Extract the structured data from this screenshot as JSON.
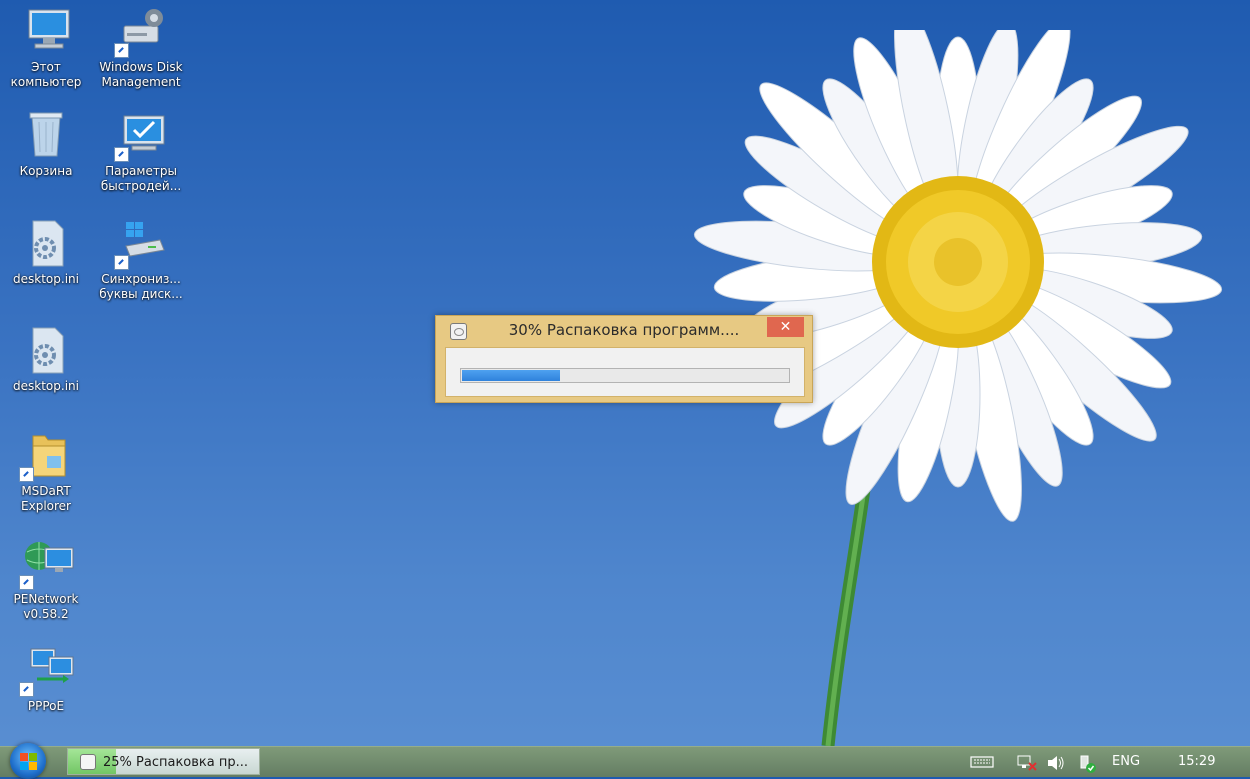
{
  "desktop": {
    "icons": [
      {
        "label": "Этот\nкомпьютер",
        "icon": "computer-icon"
      },
      {
        "label": "Windows Disk\nManagement",
        "icon": "disk-management-icon"
      },
      {
        "label": "Корзина",
        "icon": "recycle-bin-icon"
      },
      {
        "label": "Параметры\nбыстродей...",
        "icon": "performance-settings-icon"
      },
      {
        "label": "desktop.ini",
        "icon": "config-file-icon"
      },
      {
        "label": "Синхрониз...\nбуквы диск...",
        "icon": "drive-sync-icon"
      },
      {
        "label": "desktop.ini",
        "icon": "config-file-icon"
      },
      {
        "label": "MSDaRT\nExplorer",
        "icon": "folder-explorer-icon"
      },
      {
        "label": "PENetwork\nv0.58.2",
        "icon": "network-icon"
      },
      {
        "label": "PPPoE",
        "icon": "pppoe-icon"
      }
    ]
  },
  "dialog": {
    "title": "30% Распаковка программ....",
    "close_label": "✕",
    "progress": 0.3,
    "colors": {
      "frame": "#e7c983",
      "close": "#e0674f",
      "fill": "#2f82dc"
    }
  },
  "taskbar": {
    "task_label": "25% Распаковка пр...",
    "task_progress": 0.25,
    "language": "ENG",
    "clock": "15:29"
  }
}
